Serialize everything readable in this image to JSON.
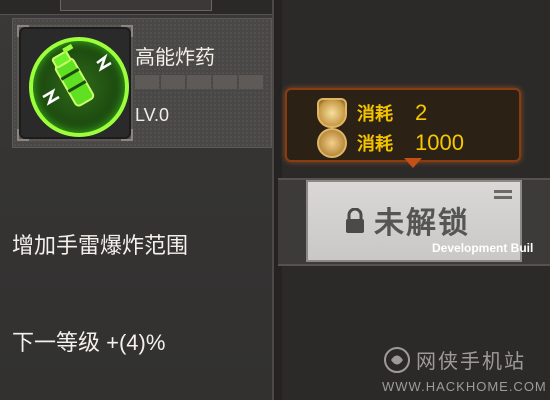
{
  "item": {
    "name": "高能炸药",
    "level": "LV.0",
    "stars_total": 5,
    "description": "增加手雷爆炸范围",
    "next_level_text": "下一等级 +(4)%"
  },
  "cost": {
    "rows": [
      {
        "icon": "rank-badge-icon",
        "label": "消耗",
        "value": "2"
      },
      {
        "icon": "gold-coin-icon",
        "label": "消耗",
        "value": "1000"
      }
    ]
  },
  "unlock": {
    "label": "未解锁",
    "icon": "lock-icon"
  },
  "overlay": {
    "dev_build": "Development Buil"
  },
  "watermark": {
    "title": "网侠手机站",
    "url": "WWW.HACKHOME.COM"
  },
  "colors": {
    "accent_gold": "#f2c200",
    "icon_green": "#9bff3b",
    "cost_border": "#8a3b12"
  }
}
